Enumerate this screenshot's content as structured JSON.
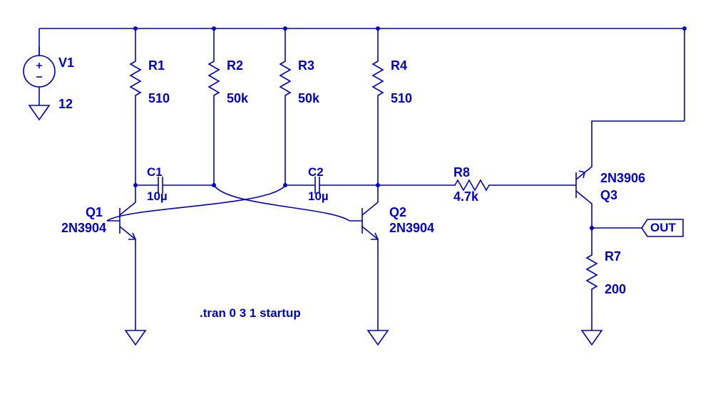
{
  "directive": ".tran 0 3 1 startup",
  "out_label": "OUT",
  "v1": {
    "name": "V1",
    "value": "12"
  },
  "r1": {
    "name": "R1",
    "value": "510"
  },
  "r2": {
    "name": "R2",
    "value": "50k"
  },
  "r3": {
    "name": "R3",
    "value": "50k"
  },
  "r4": {
    "name": "R4",
    "value": "510"
  },
  "r7": {
    "name": "R7",
    "value": "200"
  },
  "r8": {
    "name": "R8",
    "value": "4.7k"
  },
  "c1": {
    "name": "C1",
    "value": "10µ"
  },
  "c2": {
    "name": "C2",
    "value": "10µ"
  },
  "q1": {
    "name": "Q1",
    "model": "2N3904"
  },
  "q2": {
    "name": "Q2",
    "model": "2N3904"
  },
  "q3": {
    "name": "Q3",
    "model": "2N3906"
  }
}
